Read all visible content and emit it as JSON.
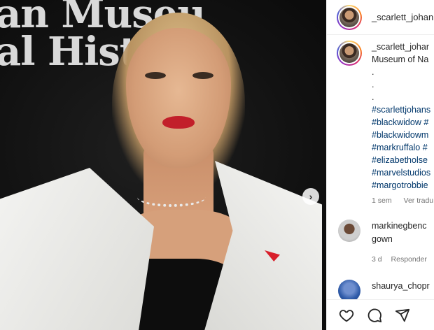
{
  "media": {
    "backdrop_line1": "an Museu",
    "backdrop_line2": "al Hist",
    "next_icon": "chevron-right-icon"
  },
  "header": {
    "username": "_scarlett_johan"
  },
  "caption": {
    "username": "_scarlett_johar",
    "lines": [
      "Museum of Na",
      ".",
      ".",
      "."
    ],
    "hashtags": [
      "#scarlettjohans",
      "#blackwidow #",
      "#blackwidowm",
      "#markruffalo #",
      "#elizabetholse",
      "#marvelstudios",
      "#margotrobbie"
    ],
    "time": "1 sem",
    "translate": "Ver tradu"
  },
  "comments": [
    {
      "username": "markinegbenc",
      "text": "gown",
      "time": "3 d",
      "reply": "Responder"
    },
    {
      "username": "shaurya_chopr",
      "text": "",
      "time": "",
      "reply": ""
    }
  ],
  "actions": {
    "like_icon": "heart-icon",
    "comment_icon": "comment-icon",
    "share_icon": "send-icon"
  }
}
